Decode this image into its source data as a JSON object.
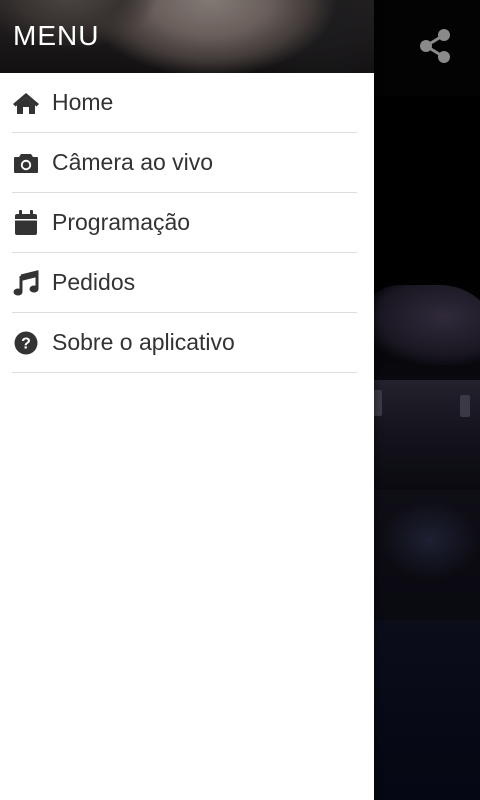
{
  "drawer": {
    "title": "MENU",
    "items": [
      {
        "label": "Home",
        "icon": "home-icon"
      },
      {
        "label": "Câmera ao vivo",
        "icon": "camera-icon"
      },
      {
        "label": "Programação",
        "icon": "calendar-icon"
      },
      {
        "label": "Pedidos",
        "icon": "music-note-icon"
      },
      {
        "label": "Sobre o aplicativo",
        "icon": "question-circle-icon"
      }
    ]
  },
  "toolbar": {
    "share_icon": "share-icon"
  },
  "colors": {
    "drawer_bg": "#ffffff",
    "text": "#333333",
    "divider": "#dddddd",
    "header_text": "#ffffff",
    "app_bg": "#000000"
  }
}
